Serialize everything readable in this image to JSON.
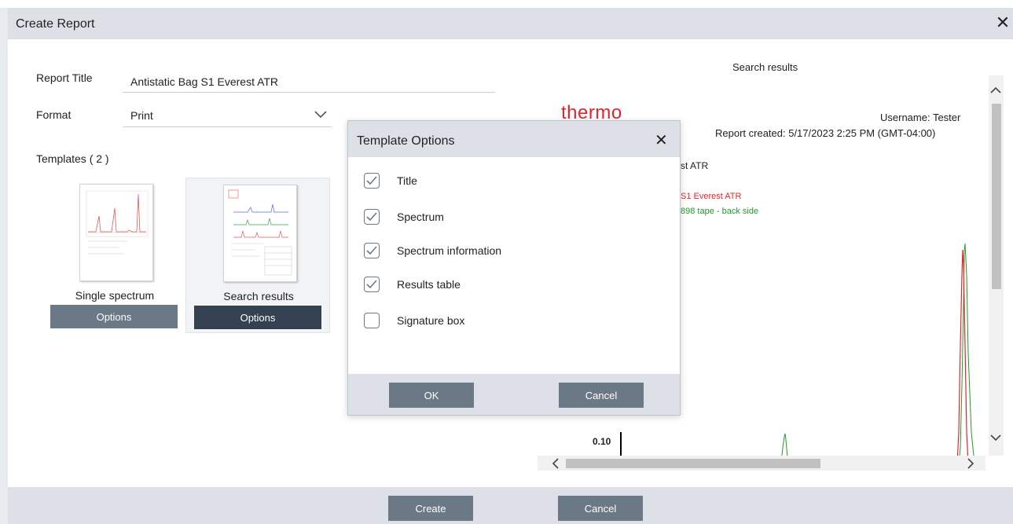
{
  "dialog": {
    "title": "Create Report",
    "close_glyph": "✕"
  },
  "form": {
    "report_title_label": "Report Title",
    "report_title_value": "Antistatic Bag S1 Everest ATR",
    "format_label": "Format",
    "format_value": "Print",
    "templates_label": "Templates ( 2 )"
  },
  "templates": [
    {
      "label": "Single spectrum",
      "button": "Options",
      "selected": false
    },
    {
      "label": "Search results",
      "button": "Options",
      "selected": true
    }
  ],
  "preview": {
    "heading": "Search results",
    "brand": "thermo",
    "username": "Username: Tester",
    "report_created": "Report created: 5/17/2023 2:25 PM (GMT-04:00)",
    "title_fragment": "st ATR",
    "legend": [
      {
        "text": "S1 Everest ATR",
        "color": "#e0262b"
      },
      {
        "text": "898 tape - back side",
        "color": "#1f9a29"
      }
    ],
    "y_tick": "0.10",
    "brand_color": "#e0262b"
  },
  "template_options": {
    "title": "Template Options",
    "close_glyph": "✕",
    "options": [
      {
        "label": "Title",
        "checked": true
      },
      {
        "label": "Spectrum",
        "checked": true
      },
      {
        "label": "Spectrum information",
        "checked": true
      },
      {
        "label": "Results table",
        "checked": true
      },
      {
        "label": "Signature box",
        "checked": false
      }
    ],
    "ok_label": "OK",
    "cancel_label": "Cancel"
  },
  "footer": {
    "create_label": "Create",
    "cancel_label": "Cancel"
  },
  "colors": {
    "header_bg": "#dde1e7",
    "button_bg": "#6b7886",
    "button_selected_bg": "#334150"
  }
}
